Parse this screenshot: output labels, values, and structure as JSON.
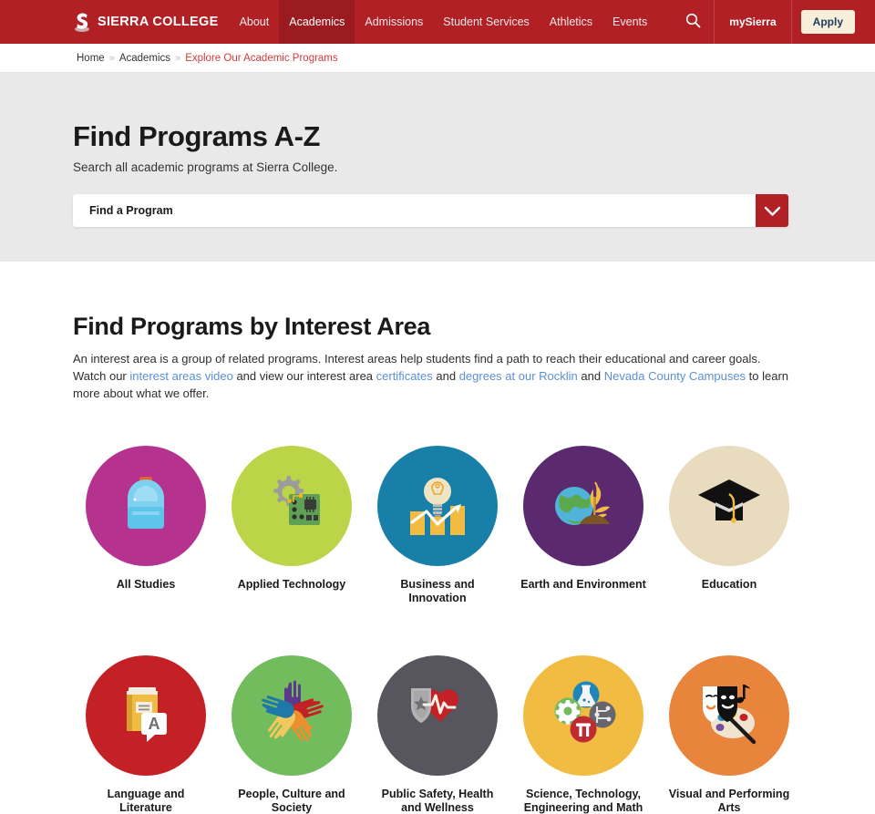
{
  "header": {
    "logo_text": "SIERRA COLLEGE",
    "logo_icon": "sierra-s-logo-icon",
    "nav": [
      {
        "label": "About",
        "active": false
      },
      {
        "label": "Academics",
        "active": true
      },
      {
        "label": "Admissions",
        "active": false
      },
      {
        "label": "Student Services",
        "active": false
      },
      {
        "label": "Athletics",
        "active": false
      },
      {
        "label": "Events",
        "active": false
      }
    ],
    "search_icon": "search-icon",
    "mysierra_label": "mySierra",
    "apply_label": "Apply",
    "bg_color": "#B02025",
    "apply_bg": "#F7EFD9",
    "apply_text_color": "#1F3C5C"
  },
  "breadcrumb": {
    "items": [
      {
        "label": "Home",
        "current": false
      },
      {
        "label": "Academics",
        "current": false
      },
      {
        "label": "Explore Our Academic Programs",
        "current": true
      }
    ],
    "separator": "»",
    "current_color": "#D23A3A"
  },
  "hero": {
    "title": "Find Programs A-Z",
    "subtitle": "Search all academic programs at Sierra College.",
    "select": {
      "value": "Find a Program",
      "arrow_icon": "chevron-down-icon",
      "arrow_bg": "#B02025"
    },
    "bg_color": "#E9E9E9"
  },
  "section": {
    "title": "Find Programs by Interest Area",
    "lead": {
      "part1": "An interest area is a group of related programs. Interest areas help students find a path to reach their educational and career goals. Watch our ",
      "link1": "interest areas video",
      "part2": " and view our interest area ",
      "link2": "certificates",
      "part3": " and ",
      "link3": "degrees at our Rocklin",
      "part4": " and ",
      "link4": "Nevada County Campuses",
      "part5": " to learn more about what we offer."
    },
    "link_color": "#5B8FD4",
    "tiles": [
      {
        "label": "All Studies",
        "icon": "backpack-icon",
        "bg": "#B5338F"
      },
      {
        "label": "Applied Technology",
        "icon": "gear-circuit-board-icon",
        "bg": "#BCD447"
      },
      {
        "label": "Business and Innovation",
        "icon": "lightbulb-bar-chart-icon",
        "bg": "#1880A8"
      },
      {
        "label": "Earth and Environment",
        "icon": "globe-wheat-icon",
        "bg": "#5B2A6E"
      },
      {
        "label": "Education",
        "icon": "graduation-cap-icon",
        "bg": "#E8DBBE"
      },
      {
        "label": "Language and Literature",
        "icon": "book-speech-bubble-icon",
        "bg": "#C42127"
      },
      {
        "label": "People, Culture and Society",
        "icon": "hands-circle-icon",
        "bg": "#73BC5E"
      },
      {
        "label": "Public Safety, Health and Wellness",
        "icon": "shield-heart-pulse-icon",
        "bg": "#57565E"
      },
      {
        "label": "Science, Technology, Engineering and Math",
        "icon": "stem-flask-gear-pi-icon",
        "bg": "#F2BC43"
      },
      {
        "label": "Visual and Performing Arts",
        "icon": "theater-masks-palette-icon",
        "bg": "#E8843C"
      }
    ]
  }
}
